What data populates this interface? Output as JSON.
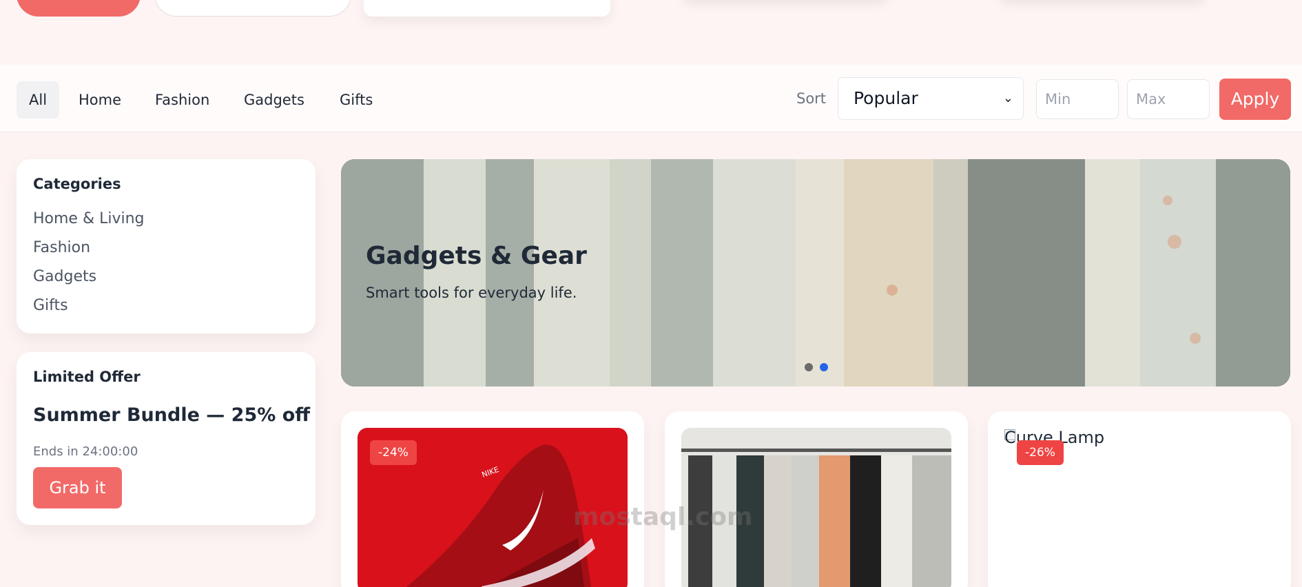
{
  "filters": {
    "chips": [
      "All",
      "Home",
      "Fashion",
      "Gadgets",
      "Gifts"
    ],
    "active_chip": "All",
    "sort_label": "Sort",
    "sort_value": "Popular",
    "min_placeholder": "Min",
    "max_placeholder": "Max",
    "apply_label": "Apply"
  },
  "sidebar": {
    "categories_title": "Categories",
    "categories": [
      "Home & Living",
      "Fashion",
      "Gadgets",
      "Gifts"
    ],
    "offer": {
      "heading": "Limited Offer",
      "title": "Summer Bundle — 25% off",
      "ends": "Ends in 24:00:00",
      "cta": "Grab it"
    }
  },
  "hero": {
    "title": "Gadgets & Gear",
    "subtitle": "Smart tools for everyday life.",
    "slides": 2,
    "active_slide": 2
  },
  "products": [
    {
      "badge": "-24%",
      "image": "red running shoe"
    },
    {
      "badge": "",
      "image": "clothes rack"
    },
    {
      "badge": "-26%",
      "alt": "Curve Lamp"
    }
  ],
  "watermark": "mostaql.com",
  "colors": {
    "accent": "#f16a68",
    "badge": "#ef4444",
    "dot_active": "#2563eb",
    "dot_inactive": "#6b6b6b"
  }
}
